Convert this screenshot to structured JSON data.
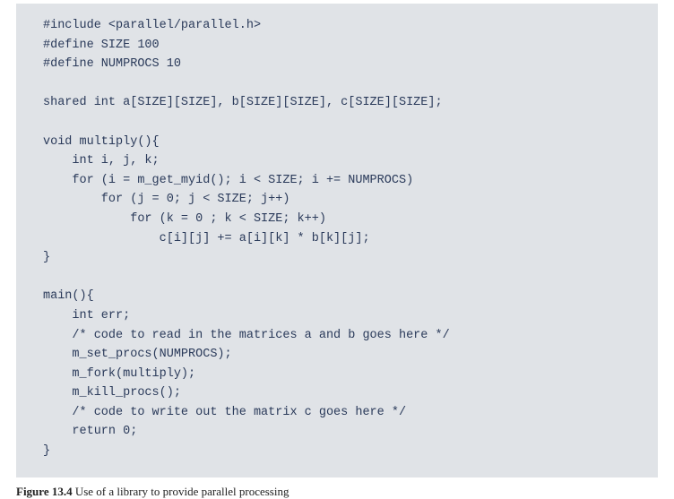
{
  "code": {
    "lines": [
      "#include <parallel/parallel.h>",
      "#define SIZE 100",
      "#define NUMPROCS 10",
      "",
      "shared int a[SIZE][SIZE], b[SIZE][SIZE], c[SIZE][SIZE];",
      "",
      "void multiply(){",
      "    int i, j, k;",
      "    for (i = m_get_myid(); i < SIZE; i += NUMPROCS)",
      "        for (j = 0; j < SIZE; j++)",
      "            for (k = 0 ; k < SIZE; k++)",
      "                c[i][j] += a[i][k] * b[k][j];",
      "}",
      "",
      "main(){",
      "    int err;",
      "    /* code to read in the matrices a and b goes here */",
      "    m_set_procs(NUMPROCS);",
      "    m_fork(multiply);",
      "    m_kill_procs();",
      "    /* code to write out the matrix c goes here */",
      "    return 0;",
      "}"
    ]
  },
  "caption": {
    "label": "Figure 13.4",
    "text": " Use of a library to provide parallel processing"
  }
}
